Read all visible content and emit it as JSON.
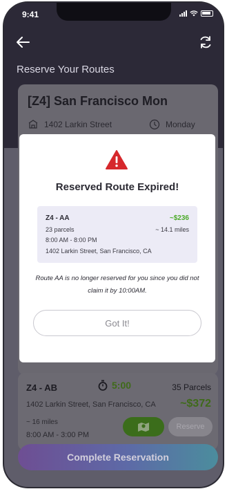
{
  "status_bar": {
    "time": "9:41"
  },
  "header": {
    "title": "Reserve Your Routes"
  },
  "background_card": {
    "title": "[Z4] San Francisco Mon",
    "address": "1402 Larkin Street",
    "day": "Monday"
  },
  "modal": {
    "title": "Reserved Route Expired!",
    "route": "Z4 - AA",
    "price": "~$236",
    "parcels": "23 parcels",
    "miles": "~ 14.1 miles",
    "time": "8:00 AM - 8:00 PM",
    "address": "1402 Larkin Street, San Francisco, CA",
    "message": "Route AA is no longer reserved for you since you did not claim it by 10:00AM.",
    "button": "Got It!"
  },
  "bottom_card": {
    "route": "Z4 - AB",
    "timer": "5:00",
    "parcels": "35 Parcels",
    "address": "1402 Larkin Street, San Francisco, CA",
    "price": "~$372",
    "miles": "~ 16 miles",
    "time": "8:00 AM - 3:00 PM",
    "reserve_label": "Reserve"
  },
  "complete_button": "Complete Reservation",
  "colors": {
    "header_bg": "#2c2937",
    "accent_green": "#4caa2a",
    "warning_red": "#d6282c"
  }
}
